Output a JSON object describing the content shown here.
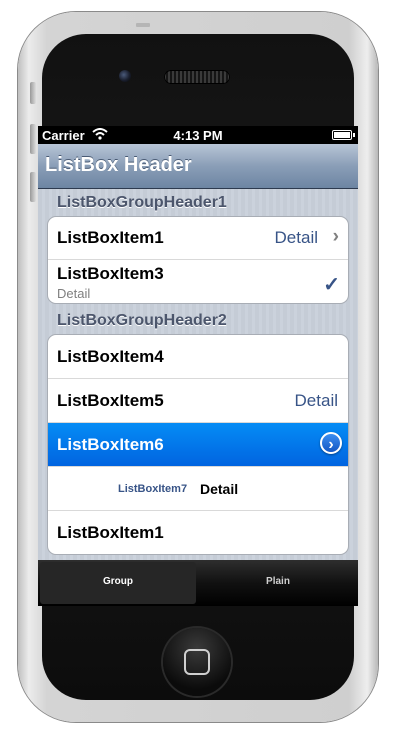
{
  "status": {
    "carrier": "Carrier",
    "time": "4:13 PM"
  },
  "nav": {
    "title": "ListBox Header"
  },
  "groups": [
    {
      "header": "ListBoxGroupHeader1",
      "items": [
        {
          "title": "ListBoxItem1",
          "detail": "Detail"
        },
        {
          "title": "ListBoxItem3",
          "subtitle": "Detail"
        }
      ]
    },
    {
      "header": "ListBoxGroupHeader2",
      "items": [
        {
          "title": "ListBoxItem4"
        },
        {
          "title": "ListBoxItem5",
          "detail": "Detail"
        },
        {
          "title": "ListBoxItem6"
        },
        {
          "label": "ListBoxItem7",
          "detail": "Detail"
        },
        {
          "title": "ListBoxItem1"
        }
      ]
    }
  ],
  "tabs": [
    {
      "label": "Group"
    },
    {
      "label": "Plain"
    }
  ],
  "colors": {
    "selected": "#0164e0",
    "detail": "#385487",
    "navbar": "#6d85a3"
  },
  "icons": {
    "status": [
      "wifi-icon",
      "battery-icon"
    ],
    "cells": [
      "chevron-right-icon",
      "checkmark-icon",
      "disclosure-button-icon"
    ]
  }
}
